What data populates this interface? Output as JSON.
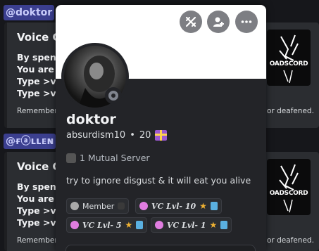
{
  "chat": {
    "messages": [
      {
        "mention": "@doktor",
        "embed": {
          "title": "Voice Ch",
          "lines": [
            "By spendi",
            "You are n",
            "Type >vlb",
            "Type >vc"
          ],
          "footer_left": "Remember",
          "footer_right": "or deafened.",
          "thumb_text": "OADSCORD"
        }
      },
      {
        "mention": "@ғⓐʟʟᴇɴ",
        "embed": {
          "title": "Voice Ch",
          "lines": [
            "By spendi",
            "You are n",
            "Type >vlb",
            "Type >vc"
          ],
          "footer_left": "Remember",
          "footer_right": "or deafened.",
          "thumb_text": "OADSCORD"
        }
      }
    ]
  },
  "popup": {
    "display_name": "doktor",
    "username": "absurdism10",
    "separator": "•",
    "badge_count": "20",
    "mutual_servers": "1 Mutual Server",
    "bio": "try to ignore disgust & it will eat you alive",
    "roles": [
      {
        "label": "Member",
        "color": "#a9a9a9"
      },
      {
        "label": "VC Lvl- 10",
        "color": "#e07de0"
      },
      {
        "label": "VC Lvl- 5",
        "color": "#e07de0"
      },
      {
        "label": "VC Lvl- 1",
        "color": "#e07de0"
      }
    ],
    "buttons": [
      "sword-icon",
      "add-friend-icon",
      "more-icon"
    ],
    "banner_color": "#ffffff"
  }
}
